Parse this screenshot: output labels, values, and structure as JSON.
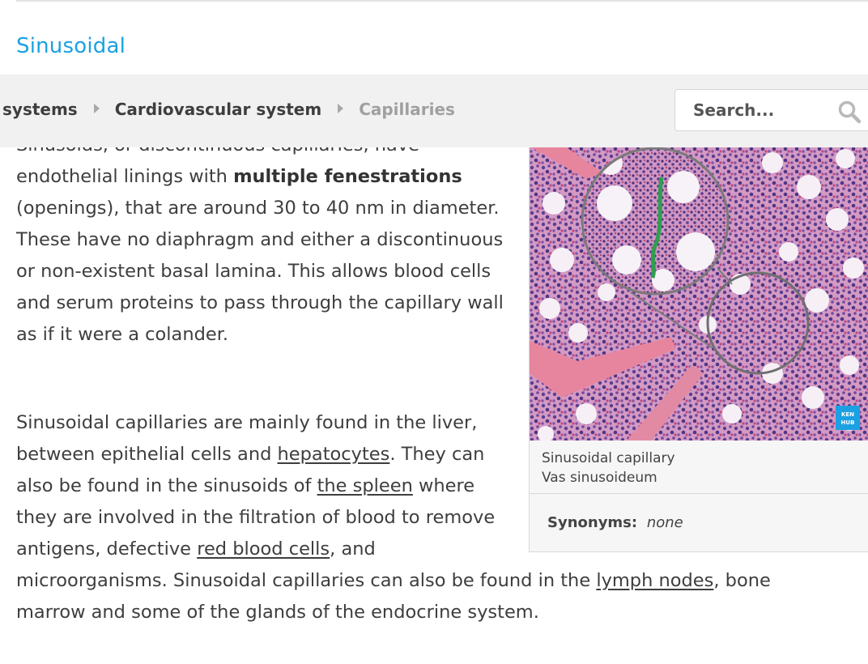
{
  "section": {
    "title": "Sinusoidal"
  },
  "breadcrumb": {
    "items": [
      "systems",
      "Cardiovascular system",
      "Capillaries"
    ]
  },
  "search": {
    "placeholder": "Search..."
  },
  "article": {
    "p1": {
      "t1": "Sinusoids, or discontinuous capillaries, have endothelial linings with ",
      "bold": "multiple fenestrations",
      "t2": " (openings), that are around 30 to 40 nm in diameter. These have no diaphragm and either a discontinuous or non-existent basal lamina. This allows blood cells and serum proteins to pass through the capillary wall as if it were a colander."
    },
    "p2": {
      "t1": "Sinusoidal capillaries are mainly found in the liver, between epithelial cells and ",
      "link1": "hepatocytes",
      "t2": ". They can also be found in the sinusoids of ",
      "link2": "the spleen",
      "t3": " where they are involved in the filtration of blood to remove antigens, defective ",
      "link3": "red blood cells",
      "t4": ", and microorganisms. Sinusoidal capillaries can also be found in the ",
      "link4": "lymph nodes",
      "t5": ", bone marrow and some of the glands of the endocrine system."
    }
  },
  "figure": {
    "caption_en": "Sinusoidal capillary",
    "caption_la": "Vas sinusoideum",
    "synonyms_label": "Synonyms:",
    "synonyms_value": "none",
    "logo_text": "KEN HUB",
    "colors": {
      "tissue": "#cf8fbf",
      "bone": "#e9849f",
      "highlight": "#2f9e4f",
      "logo": "#1ba1e2"
    }
  },
  "colors": {
    "accent": "#1ba1e2",
    "text": "#3e3e3e",
    "bar": "#f1f1f1"
  }
}
